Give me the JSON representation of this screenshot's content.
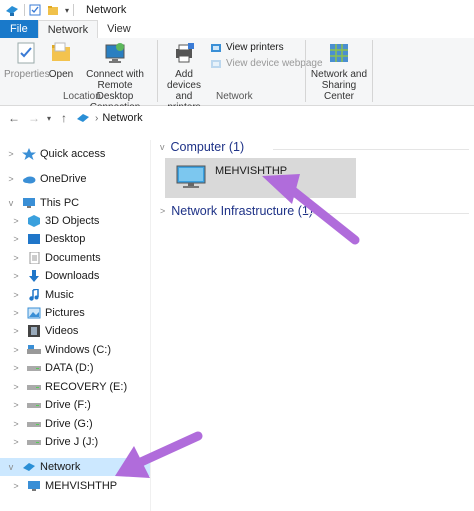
{
  "window": {
    "title": "Network"
  },
  "tabs": [
    {
      "label": "File"
    },
    {
      "label": "Network"
    },
    {
      "label": "View"
    }
  ],
  "ribbon": {
    "location_group": "Location",
    "network_group": "Network",
    "properties": "Properties",
    "open": "Open",
    "connect_line1": "Connect with Remote",
    "connect_line2": "Desktop Connection",
    "add_devices_line1": "Add devices",
    "add_devices_line2": "and printers",
    "view_printers": "View printers",
    "view_device_webpage": "View device webpage",
    "nsc_line1": "Network and",
    "nsc_line2": "Sharing Center"
  },
  "address": {
    "crumb": "Network"
  },
  "sidebar": {
    "items": [
      {
        "label": "Quick access"
      },
      {
        "label": "OneDrive"
      },
      {
        "label": "This PC"
      },
      {
        "label": "3D Objects"
      },
      {
        "label": "Desktop"
      },
      {
        "label": "Documents"
      },
      {
        "label": "Downloads"
      },
      {
        "label": "Music"
      },
      {
        "label": "Pictures"
      },
      {
        "label": "Videos"
      },
      {
        "label": "Windows (C:)"
      },
      {
        "label": "DATA (D:)"
      },
      {
        "label": "RECOVERY (E:)"
      },
      {
        "label": "Drive (F:)"
      },
      {
        "label": "Drive (G:)"
      },
      {
        "label": "Drive J (J:)"
      },
      {
        "label": "Network"
      },
      {
        "label": "MEHVISHTHP"
      }
    ]
  },
  "content": {
    "computer_group": "Computer (1)",
    "computer_name": "MEHVISHTHP",
    "infra_group": "Network Infrastructure (1)"
  },
  "colors": {
    "accent": "#1979ca",
    "selected": "#cce8ff",
    "annotation_arrow": "#b06cdb",
    "group_header": "#1e3287"
  }
}
